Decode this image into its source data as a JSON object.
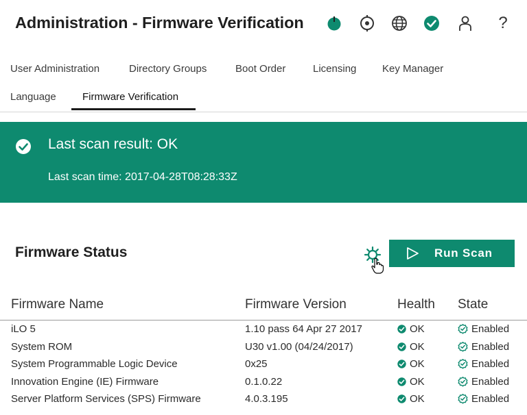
{
  "header": {
    "title": "Administration - Firmware Verification",
    "icons": [
      "power-icon",
      "location-icon",
      "globe-icon",
      "health-ok-icon",
      "user-icon",
      "help-icon"
    ],
    "help_glyph": "?"
  },
  "tabs": [
    {
      "label": "User Administration",
      "active": false
    },
    {
      "label": "Directory Groups",
      "active": false
    },
    {
      "label": "Boot Order",
      "active": false
    },
    {
      "label": "Licensing",
      "active": false
    },
    {
      "label": "Key Manager",
      "active": false
    },
    {
      "label": "Language",
      "active": false
    },
    {
      "label": "Firmware Verification",
      "active": true
    }
  ],
  "banner": {
    "result": "Last scan result: OK",
    "time": "Last scan time: 2017-04-28T08:28:33Z"
  },
  "firmware_status": {
    "title": "Firmware Status",
    "run_scan_label": "Run Scan",
    "columns": [
      "Firmware Name",
      "Firmware Version",
      "Health",
      "State"
    ],
    "rows": [
      {
        "name": "iLO 5",
        "version": "1.10 pass 64 Apr 27 2017",
        "health": "OK",
        "state": "Enabled"
      },
      {
        "name": "System ROM",
        "version": "U30 v1.00 (04/24/2017)",
        "health": "OK",
        "state": "Enabled"
      },
      {
        "name": "System Programmable Logic Device",
        "version": "0x25",
        "health": "OK",
        "state": "Enabled"
      },
      {
        "name": "Innovation Engine (IE) Firmware",
        "version": "0.1.0.22",
        "health": "OK",
        "state": "Enabled"
      },
      {
        "name": "Server Platform Services (SPS) Firmware",
        "version": "4.0.3.195",
        "health": "OK",
        "state": "Enabled"
      }
    ]
  },
  "colors": {
    "accent": "#0e8a6f",
    "ok": "#0e8a6f"
  }
}
